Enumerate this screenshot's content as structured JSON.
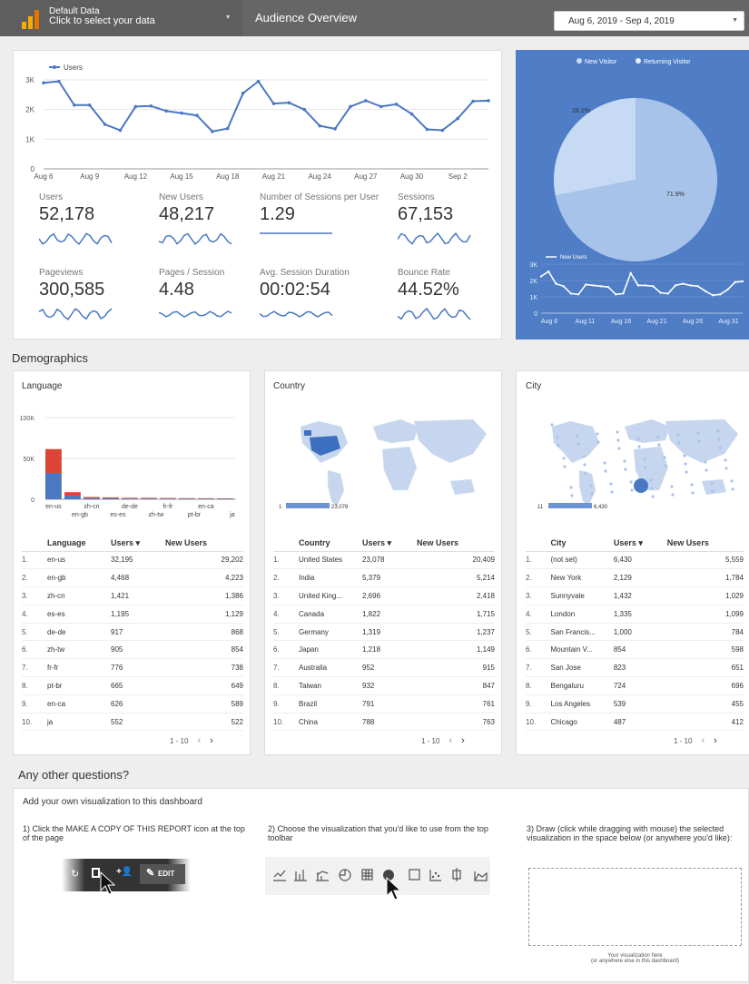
{
  "header": {
    "data_source_line1": "Default Data",
    "data_source_line2": "Click to select your data",
    "title": "Audience Overview",
    "date_range": "Aug 6, 2019 - Sep 4, 2019"
  },
  "overview": {
    "legend": "Users",
    "y_ticks": [
      "3K",
      "2K",
      "1K",
      "0"
    ],
    "x_ticks": [
      "Aug 6",
      "Aug 9",
      "Aug 12",
      "Aug 15",
      "Aug 18",
      "Aug 21",
      "Aug 24",
      "Aug 27",
      "Aug 30",
      "Sep 2"
    ],
    "metrics": [
      {
        "label": "Users",
        "value": "52,178"
      },
      {
        "label": "New Users",
        "value": "48,217"
      },
      {
        "label": "Number of Sessions per User",
        "value": "1.29"
      },
      {
        "label": "Sessions",
        "value": "67,153"
      },
      {
        "label": "Pageviews",
        "value": "300,585"
      },
      {
        "label": "Pages / Session",
        "value": "4.48"
      },
      {
        "label": "Avg. Session Duration",
        "value": "00:02:54"
      },
      {
        "label": "Bounce Rate",
        "value": "44.52%"
      }
    ]
  },
  "visitor_panel": {
    "pie_legend": [
      "New Visitor",
      "Returning Visitor"
    ],
    "pie_labels": [
      "28.1%",
      "71.9%"
    ],
    "line_legend": "New Users",
    "y_ticks": [
      "3K",
      "2K",
      "1K",
      "0"
    ],
    "x_ticks": [
      "Aug 6",
      "Aug 11",
      "Aug 16",
      "Aug 21",
      "Aug 26",
      "Aug 31"
    ]
  },
  "chart_data": [
    {
      "type": "line",
      "series": [
        {
          "name": "Users",
          "values": [
            2900,
            2950,
            2150,
            2150,
            1500,
            1300,
            2100,
            2120,
            1950,
            1880,
            1800,
            1260,
            1360,
            2550,
            2950,
            2200,
            2230,
            2000,
            1450,
            1350,
            2100,
            2300,
            2100,
            2180,
            1850,
            1330,
            1300,
            1700,
            2280,
            2300
          ]
        }
      ],
      "x_ticks": [
        "Aug 6",
        "Aug 9",
        "Aug 12",
        "Aug 15",
        "Aug 18",
        "Aug 21",
        "Aug 24",
        "Aug 27",
        "Aug 30",
        "Sep 2"
      ],
      "ylim": [
        0,
        3000
      ],
      "legend": "top-left"
    },
    {
      "type": "pie",
      "series": [
        {
          "name": "Returning Visitor",
          "value": 71.9
        },
        {
          "name": "New Visitor",
          "value": 28.1
        }
      ],
      "legend": "top"
    },
    {
      "type": "line",
      "series": [
        {
          "name": "New Users",
          "values": [
            2250,
            2550,
            1800,
            1650,
            1200,
            1150,
            1750,
            1700,
            1650,
            1600,
            1150,
            1200,
            2450,
            1700,
            1700,
            1650,
            1250,
            1200,
            1700,
            1800,
            1700,
            1650,
            1350,
            1100,
            1150,
            1450,
            1900,
            1950
          ]
        }
      ],
      "x_ticks": [
        "Aug 6",
        "Aug 11",
        "Aug 16",
        "Aug 21",
        "Aug 26",
        "Aug 31"
      ],
      "ylim": [
        0,
        3000
      ],
      "legend": "top-left"
    },
    {
      "type": "bar",
      "categories": [
        "en-us",
        "en-gb",
        "zh-cn",
        "es-es",
        "de-de",
        "zh-tw",
        "fr-fr",
        "pt-br",
        "en-ca",
        "ja"
      ],
      "series": [
        {
          "name": "Users",
          "values": [
            32195,
            4468,
            1421,
            1195,
            917,
            905,
            776,
            665,
            626,
            552
          ]
        },
        {
          "name": "New Users",
          "values": [
            29202,
            4223,
            1386,
            1129,
            868,
            854,
            738,
            649,
            589,
            522
          ]
        }
      ],
      "y_ticks": [
        "100K",
        "50K",
        "0"
      ],
      "ylim": [
        0,
        100000
      ],
      "stacked": true
    }
  ],
  "demographics": {
    "title": "Demographics",
    "language": {
      "title": "Language",
      "headers": [
        "Language",
        "Users ▾",
        "New Users"
      ],
      "rows": [
        [
          "1.",
          "en-us",
          "32,195",
          "29,202"
        ],
        [
          "2.",
          "en-gb",
          "4,468",
          "4,223"
        ],
        [
          "3.",
          "zh-cn",
          "1,421",
          "1,386"
        ],
        [
          "4.",
          "es-es",
          "1,195",
          "1,129"
        ],
        [
          "5.",
          "de-de",
          "917",
          "868"
        ],
        [
          "6.",
          "zh-tw",
          "905",
          "854"
        ],
        [
          "7.",
          "fr-fr",
          "776",
          "738"
        ],
        [
          "8.",
          "pt-br",
          "665",
          "649"
        ],
        [
          "9.",
          "en-ca",
          "626",
          "589"
        ],
        [
          "10.",
          "ja",
          "552",
          "522"
        ]
      ],
      "pager": "1 - 10"
    },
    "country": {
      "title": "Country",
      "scale_min": "1",
      "scale_max": "23,078",
      "headers": [
        "Country",
        "Users ▾",
        "New Users"
      ],
      "rows": [
        [
          "1.",
          "United States",
          "23,078",
          "20,409"
        ],
        [
          "2.",
          "India",
          "5,379",
          "5,214"
        ],
        [
          "3.",
          "United King...",
          "2,696",
          "2,418"
        ],
        [
          "4.",
          "Canada",
          "1,822",
          "1,715"
        ],
        [
          "5.",
          "Germany",
          "1,319",
          "1,237"
        ],
        [
          "6.",
          "Japan",
          "1,218",
          "1,149"
        ],
        [
          "7.",
          "Australia",
          "952",
          "915"
        ],
        [
          "8.",
          "Taiwan",
          "932",
          "847"
        ],
        [
          "9.",
          "Brazil",
          "791",
          "761"
        ],
        [
          "10.",
          "China",
          "788",
          "763"
        ]
      ],
      "pager": "1 - 10"
    },
    "city": {
      "title": "City",
      "scale_min": "11",
      "scale_max": "6,430",
      "headers": [
        "City",
        "Users ▾",
        "New Users"
      ],
      "rows": [
        [
          "1.",
          "(not set)",
          "6,430",
          "5,559"
        ],
        [
          "2.",
          "New York",
          "2,129",
          "1,784"
        ],
        [
          "3.",
          "Sunnyvale",
          "1,432",
          "1,029"
        ],
        [
          "4.",
          "London",
          "1,335",
          "1,099"
        ],
        [
          "5.",
          "San Francis...",
          "1,000",
          "784"
        ],
        [
          "6.",
          "Mountain V...",
          "854",
          "598"
        ],
        [
          "7.",
          "San Jose",
          "823",
          "651"
        ],
        [
          "8.",
          "Bengaluru",
          "724",
          "696"
        ],
        [
          "9.",
          "Los Angeles",
          "539",
          "455"
        ],
        [
          "10.",
          "Chicago",
          "487",
          "412"
        ]
      ],
      "pager": "1 - 10"
    }
  },
  "questions": {
    "title": "Any other questions?",
    "intro": "Add your own visualization to this dashboard",
    "step1": "1) Click the MAKE A COPY OF THIS REPORT icon at the top of the page",
    "step2": "2) Choose the visualization that you'd like to use from the top toolbar",
    "step3": "3) Draw (click while dragging with mouse) the selected visualization in the space below (or anywhere you'd like):",
    "edit_label": "EDIT",
    "draw_line1": "Your visualization here",
    "draw_line2": "(or anywhere else in this dashboard)"
  },
  "colors": {
    "line": "#4a78c2",
    "blue_panel": "#4f7ec7",
    "red": "#db4437",
    "map_fill": "#c5d6ee"
  }
}
